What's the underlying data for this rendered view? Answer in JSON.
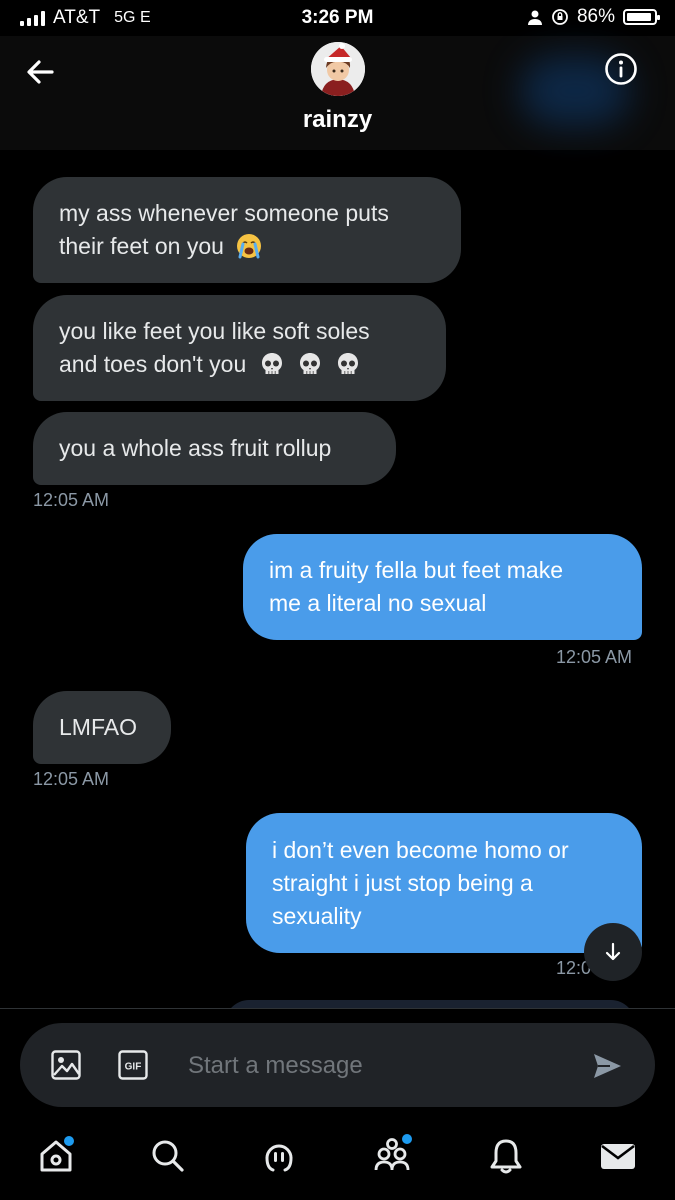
{
  "status_bar": {
    "carrier": "AT&T",
    "network": "5G E",
    "time": "3:26 PM",
    "battery": "86%",
    "battery_level": 0.86
  },
  "header": {
    "name": "rainzy",
    "avatar": "avatar-icon",
    "back_icon": "back-arrow-icon",
    "info_icon": "info-icon"
  },
  "messages": [
    {
      "from": "them",
      "lines": [
        "my ass whenever someone puts",
        "their feet on you"
      ],
      "emoji": "loudly-crying-face-emoji"
    },
    {
      "from": "them",
      "lines": [
        "you like feet you like soft soles",
        "and toes don't you"
      ],
      "emoji": "skull-emoji x3"
    },
    {
      "from": "them",
      "lines": [
        "you a whole ass fruit rollup"
      ],
      "time": "12:05 AM"
    },
    {
      "from": "me",
      "lines": [
        "im a fruity fella but feet make",
        "me a literal no sexual"
      ],
      "time": "12:05 AM"
    },
    {
      "from": "them",
      "lines": [
        "LMFAO"
      ],
      "time": "12:05 AM"
    },
    {
      "from": "me",
      "lines": [
        "i don’t even become homo or",
        "straight i just stop being a",
        "sexuality"
      ],
      "time": "12:0"
    }
  ],
  "composer": {
    "placeholder": "Start a message",
    "gif_label": "GIF"
  },
  "tabs": [
    "home-icon",
    "search-icon",
    "spaces-icon",
    "communities-icon",
    "notifications-icon",
    "messages-icon"
  ],
  "colors": {
    "background": "#000000",
    "received_bubble": "#2f3336",
    "sent_bubble": "#4a9cea",
    "accent": "#1d9bf0",
    "timestamp": "#8b98a5"
  }
}
